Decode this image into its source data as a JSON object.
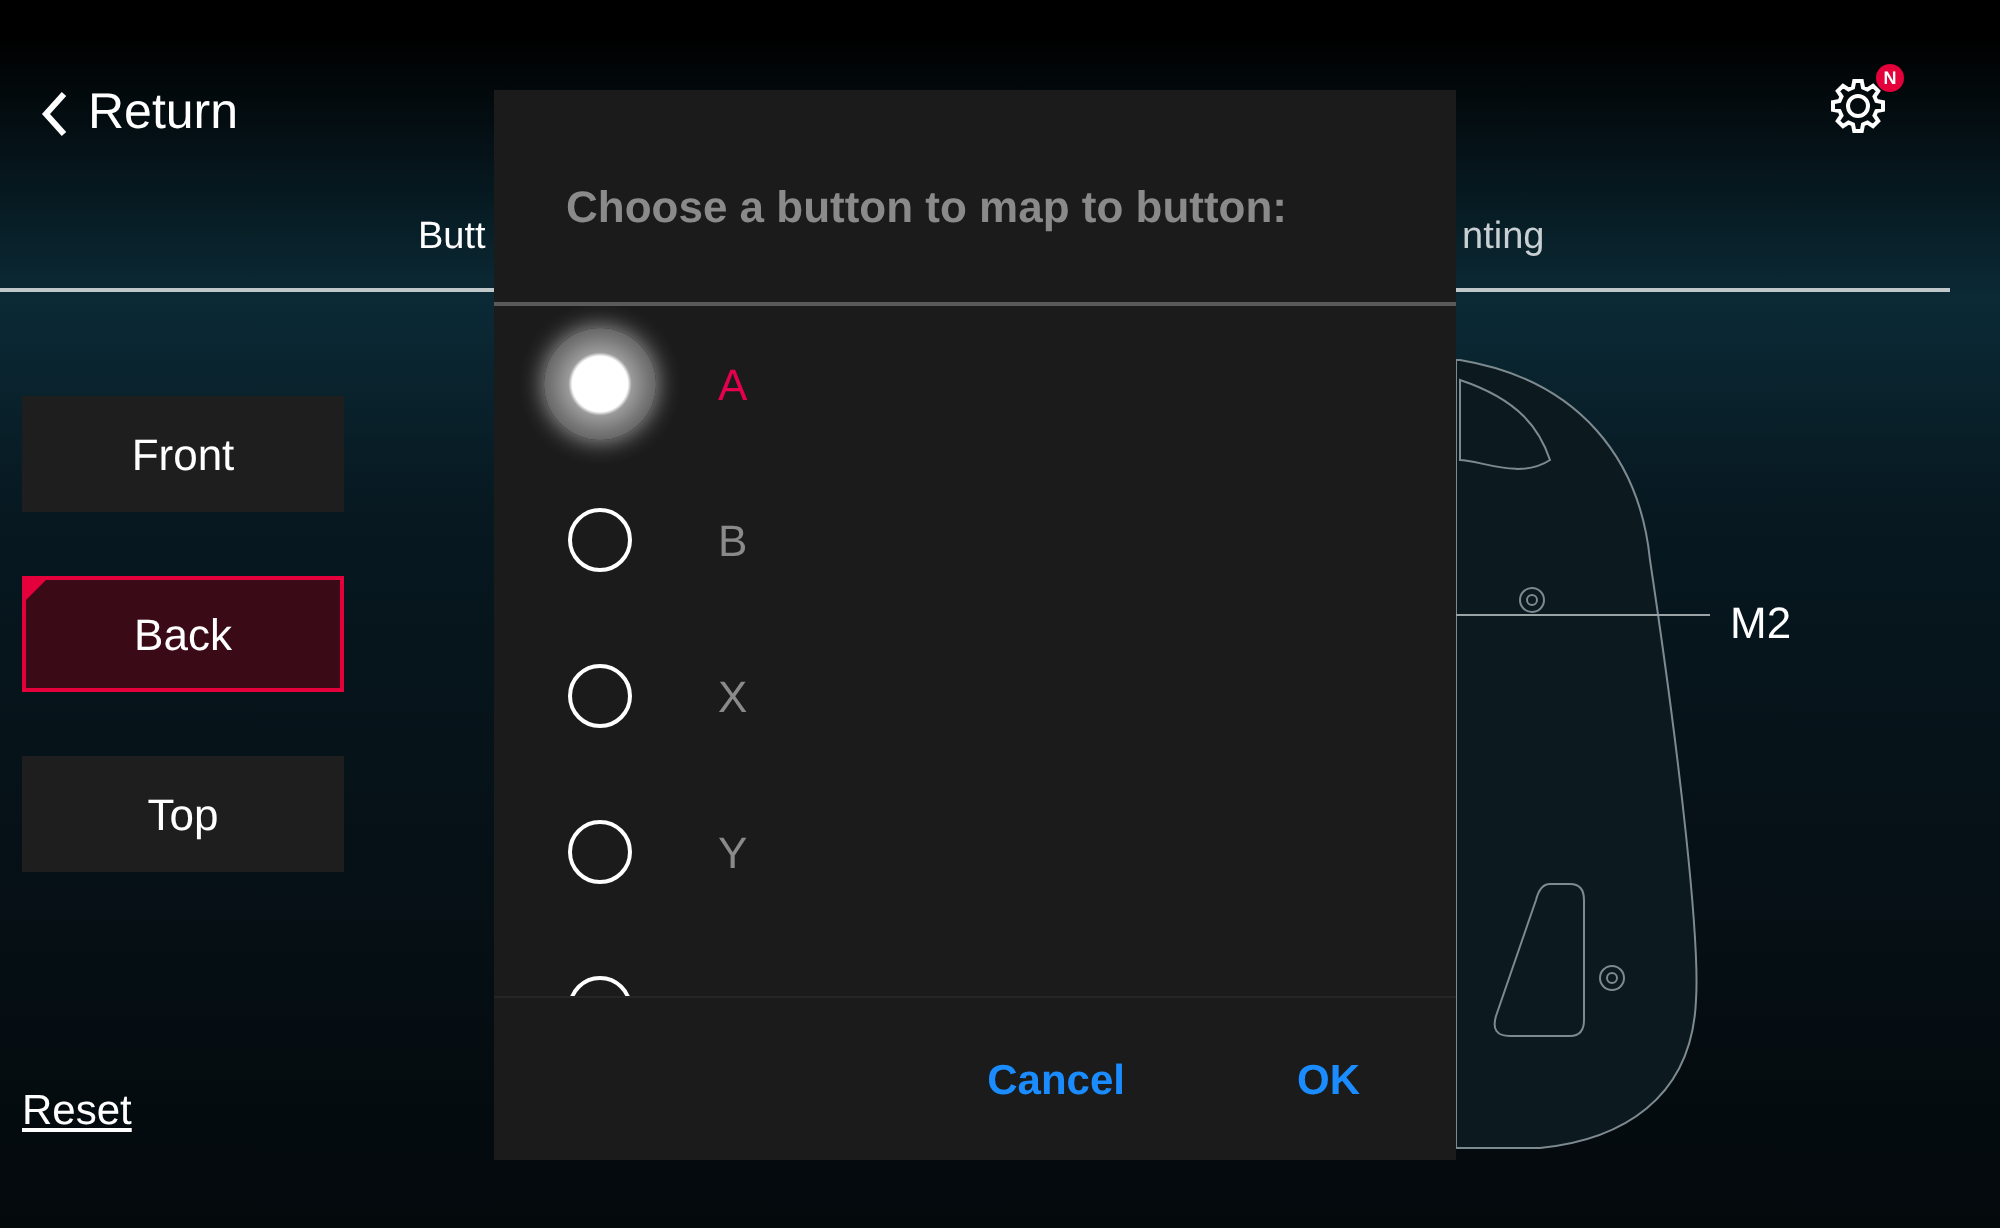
{
  "header": {
    "back_label": "Return",
    "settings_badge": "N"
  },
  "tabs": [
    {
      "label": "Butt",
      "selected": true
    },
    {
      "label": "nting",
      "selected": false
    }
  ],
  "sides": [
    {
      "label": "Front",
      "selected": false
    },
    {
      "label": "Back",
      "selected": true
    },
    {
      "label": "Top",
      "selected": false
    }
  ],
  "reset_link": "Reset",
  "diagram": {
    "callout": "M2"
  },
  "dialog": {
    "title": "Choose a button to map to button:",
    "options": [
      {
        "label": "A",
        "selected": true
      },
      {
        "label": "B",
        "selected": false
      },
      {
        "label": "X",
        "selected": false
      },
      {
        "label": "Y",
        "selected": false
      },
      {
        "selected": false
      }
    ],
    "buttons": [
      "Cancel",
      "OK"
    ]
  }
}
